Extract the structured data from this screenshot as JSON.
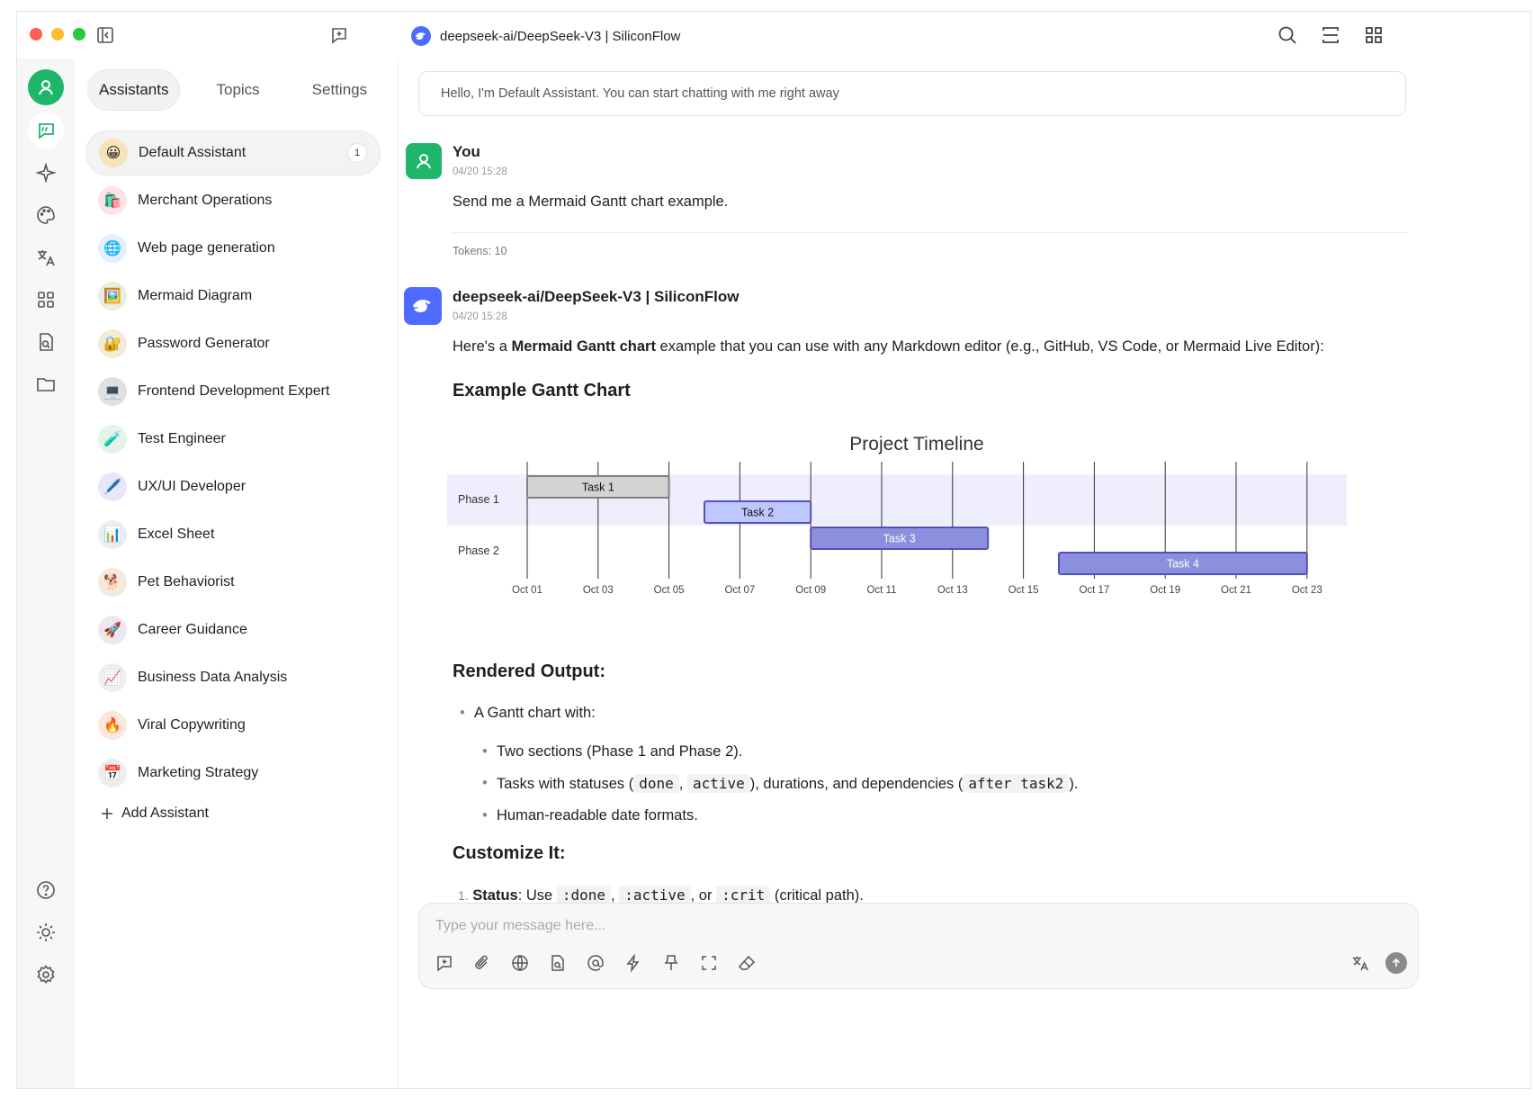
{
  "window": {
    "title": "deepseek-ai/DeepSeek-V3 | SiliconFlow"
  },
  "rail": {
    "items": [
      "chat-icon",
      "sparkle-icon",
      "palette-icon",
      "translate-icon",
      "apps-icon",
      "doc-search-icon",
      "folder-icon"
    ],
    "bottom": [
      "help-icon",
      "sun-icon",
      "gear-icon"
    ]
  },
  "panel": {
    "tabs": [
      {
        "label": "Assistants",
        "active": true
      },
      {
        "label": "Topics",
        "active": false
      },
      {
        "label": "Settings",
        "active": false
      }
    ],
    "assistants": [
      {
        "emoji": "😀",
        "name": "Default Assistant",
        "count": "1",
        "active": true,
        "bg": "#f6e3b8"
      },
      {
        "emoji": "🛍️",
        "name": "Merchant Operations",
        "bg": "#fde2e6"
      },
      {
        "emoji": "🌐",
        "name": "Web page generation",
        "bg": "#e3f0fb"
      },
      {
        "emoji": "🖼️",
        "name": "Mermaid Diagram",
        "bg": "#e6efe0"
      },
      {
        "emoji": "🔐",
        "name": "Password Generator",
        "bg": "#f4ead8"
      },
      {
        "emoji": "💻",
        "name": "Frontend Development Expert",
        "bg": "#e0e0e0"
      },
      {
        "emoji": "🧪",
        "name": "Test Engineer",
        "bg": "#e4f4e4"
      },
      {
        "emoji": "🖊️",
        "name": "UX/UI Developer",
        "bg": "#e6e8f7"
      },
      {
        "emoji": "📊",
        "name": "Excel Sheet",
        "bg": "#e8eef6"
      },
      {
        "emoji": "🐕",
        "name": "Pet Behaviorist",
        "bg": "#f5e8dc"
      },
      {
        "emoji": "🚀",
        "name": "Career Guidance",
        "bg": "#ece8f2"
      },
      {
        "emoji": "📈",
        "name": "Business Data Analysis",
        "bg": "#f0eef0"
      },
      {
        "emoji": "🔥",
        "name": "Viral Copywriting",
        "bg": "#fde7dc"
      },
      {
        "emoji": "📅",
        "name": "Marketing Strategy",
        "bg": "#eeeeee"
      }
    ],
    "add_label": "Add Assistant"
  },
  "chat": {
    "welcome": "Hello, I'm Default Assistant. You can start chatting with me right away",
    "user": {
      "name": "You",
      "time": "04/20 15:28",
      "text": "Send me a Mermaid Gantt chart example.",
      "tokens": "Tokens: 10"
    },
    "bot": {
      "name": "deepseek-ai/DeepSeek-V3 | SiliconFlow",
      "time": "04/20 15:28",
      "intro_pre": "Here's a ",
      "intro_bold": "Mermaid Gantt chart",
      "intro_post": " example that you can use with any Markdown editor (e.g., GitHub, VS Code, or Mermaid Live Editor):",
      "h_example": "Example Gantt Chart",
      "h_rendered": "Rendered Output:",
      "bullet_main": "A Gantt chart with:",
      "bullet_sections": "Two sections (Phase 1 and Phase 2).",
      "bullet_status_pre": "Tasks with statuses (",
      "code_done": "done",
      "sep_comma": ",",
      "code_active": "active",
      "bullet_status_mid": "), durations, and dependencies (",
      "code_after": "after task2",
      "bullet_status_end": ").",
      "bullet_dates": "Human-readable date formats.",
      "h_customize": "Customize It:",
      "custom_num": "1.",
      "custom_bold": "Status",
      "custom_use": ": Use",
      "code_cdone": ":done",
      "code_cactive": ":active",
      "custom_or": ", or",
      "code_crit": ":crit",
      "custom_end": "(critical path)."
    }
  },
  "chart_data": {
    "type": "gantt",
    "title": "Project Timeline",
    "sections": [
      "Phase 1",
      "Phase 2"
    ],
    "ticks": [
      "Oct 01",
      "Oct 03",
      "Oct 05",
      "Oct 07",
      "Oct 09",
      "Oct 11",
      "Oct 13",
      "Oct 15",
      "Oct 17",
      "Oct 19",
      "Oct 21",
      "Oct 23"
    ],
    "tasks": [
      {
        "name": "Task 1",
        "section": "Phase 1",
        "start": "2023-10-01",
        "end": "2023-10-05",
        "status": "done",
        "fill": "#d3d3d3",
        "stroke": "#808080",
        "text": "#111111"
      },
      {
        "name": "Task 2",
        "section": "Phase 1",
        "start": "2023-10-06",
        "end": "2023-10-09",
        "status": "active",
        "fill": "#bfc7ff",
        "stroke": "#534fbc",
        "text": "#111111"
      },
      {
        "name": "Task 3",
        "section": "Phase 2",
        "start": "2023-10-09",
        "end": "2023-10-14",
        "status": "normal",
        "fill": "#8a90dd",
        "stroke": "#534fbc",
        "text": "#ffffff"
      },
      {
        "name": "Task 4",
        "section": "Phase 2",
        "start": "2023-10-16",
        "end": "2023-10-23",
        "status": "normal",
        "fill": "#8a90dd",
        "stroke": "#534fbc",
        "text": "#ffffff"
      }
    ],
    "colors": {
      "phase1_band": "#eeeefd",
      "grid": "#333333"
    }
  },
  "composer": {
    "placeholder": "Type your message here...",
    "tools": [
      "new-topic-icon",
      "attachment-icon",
      "globe-icon",
      "doc-search-icon",
      "mention-icon",
      "lightning-icon",
      "pin-icon",
      "fullscreen-icon",
      "eraser-icon"
    ]
  },
  "colors": {
    "accent": "#1fb56b",
    "brand_model": "#4d6bfe"
  }
}
